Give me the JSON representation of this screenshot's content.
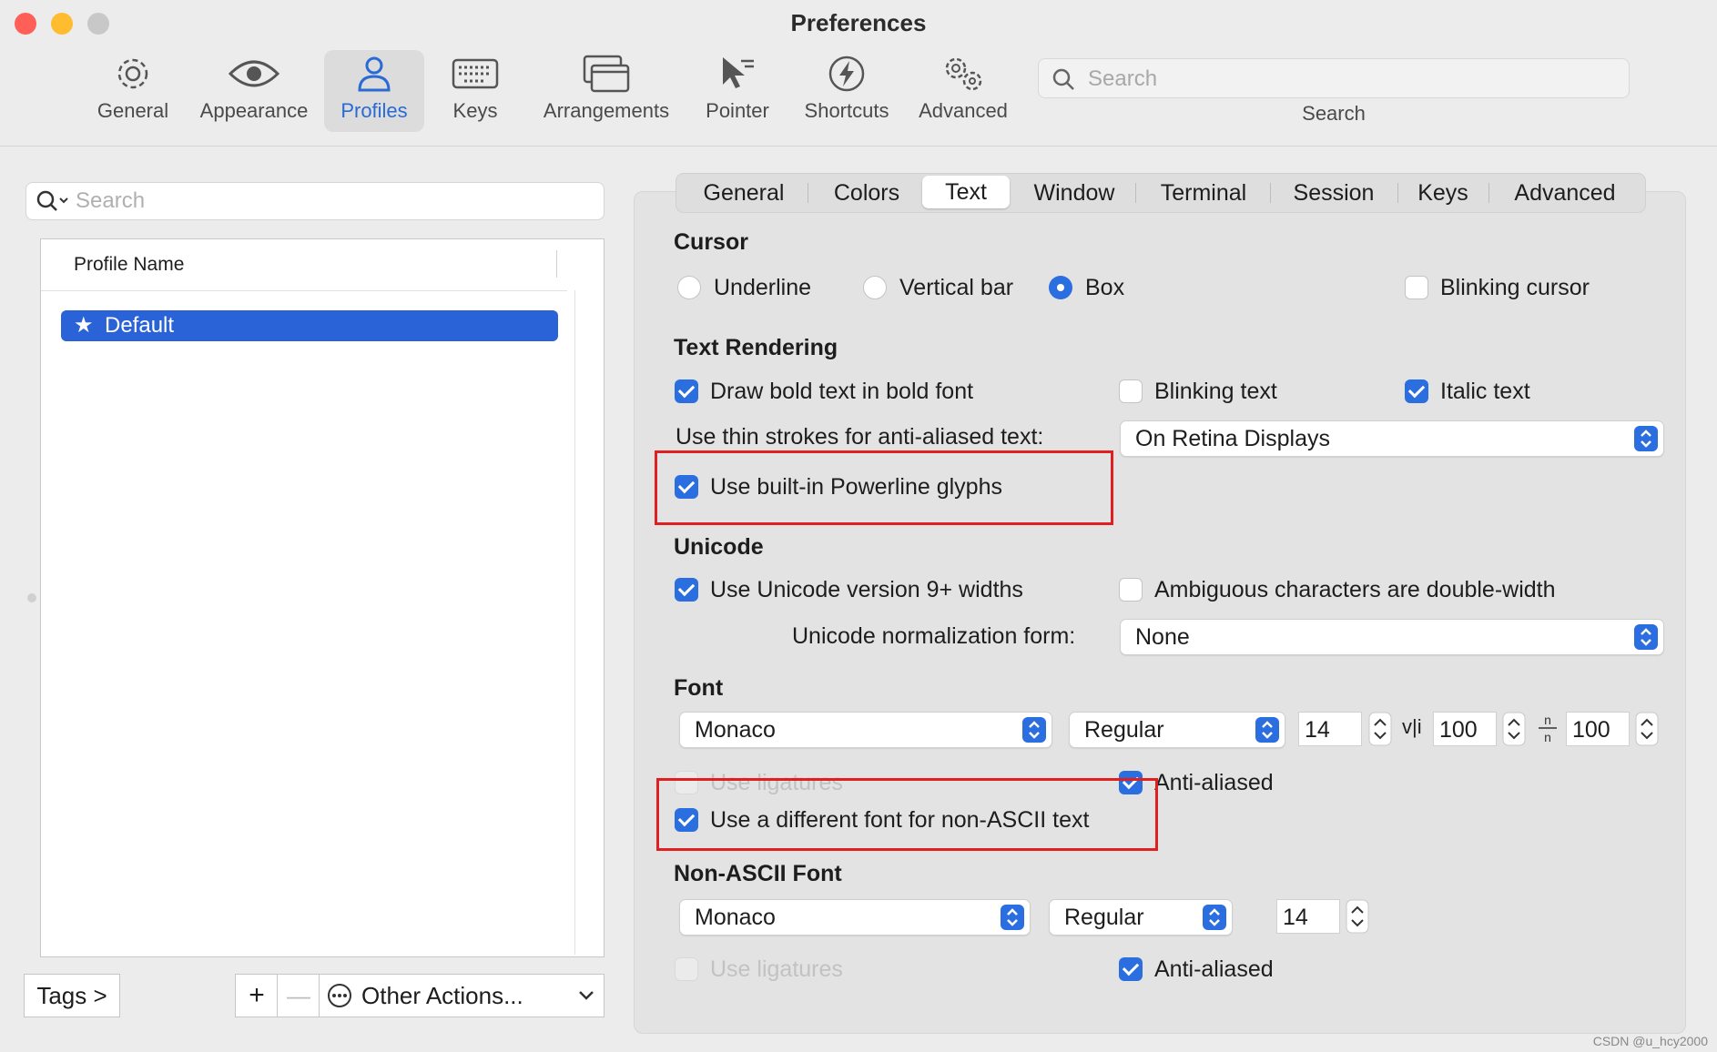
{
  "window": {
    "title": "Preferences"
  },
  "toolbar": {
    "items": [
      {
        "label": "General",
        "icon": "gear-icon"
      },
      {
        "label": "Appearance",
        "icon": "eye-icon"
      },
      {
        "label": "Profiles",
        "icon": "person-icon",
        "selected": true
      },
      {
        "label": "Keys",
        "icon": "keyboard-icon"
      },
      {
        "label": "Arrangements",
        "icon": "windows-icon"
      },
      {
        "label": "Pointer",
        "icon": "pointer-icon"
      },
      {
        "label": "Shortcuts",
        "icon": "bolt-icon"
      },
      {
        "label": "Advanced",
        "icon": "gears-icon"
      }
    ],
    "search_placeholder": "Search",
    "search_label": "Search"
  },
  "profiles": {
    "search_placeholder": "Search",
    "column_header": "Profile Name",
    "items": [
      {
        "name": "Default",
        "starred": true,
        "selected": true
      }
    ],
    "tags_button": "Tags >",
    "add_symbol": "+",
    "remove_symbol": "—",
    "other_actions": "Other Actions..."
  },
  "tabs": [
    "General",
    "Colors",
    "Text",
    "Window",
    "Terminal",
    "Session",
    "Keys",
    "Advanced"
  ],
  "selected_tab": "Text",
  "cursor": {
    "heading": "Cursor",
    "options": [
      "Underline",
      "Vertical bar",
      "Box"
    ],
    "selected": "Box",
    "blinking_label": "Blinking cursor",
    "blinking": false
  },
  "text_rendering": {
    "heading": "Text Rendering",
    "bold_label": "Draw bold text in bold font",
    "bold": true,
    "blinking_text_label": "Blinking text",
    "blinking_text": false,
    "italic_label": "Italic text",
    "italic": true,
    "thin_strokes_label": "Use thin strokes for anti-aliased text:",
    "thin_strokes_value": "On Retina Displays",
    "powerline_label": "Use built-in Powerline glyphs",
    "powerline": true
  },
  "unicode": {
    "heading": "Unicode",
    "v9_label": "Use Unicode version 9+ widths",
    "v9": true,
    "ambiguous_label": "Ambiguous characters are double-width",
    "ambiguous": false,
    "normalization_label": "Unicode normalization form:",
    "normalization_value": "None"
  },
  "font": {
    "heading": "Font",
    "family": "Monaco",
    "style": "Regular",
    "size": "14",
    "vspace_glyph": "v|i",
    "vspace": "100",
    "hspace": "100",
    "ligatures_label": "Use ligatures",
    "ligatures": false,
    "antialiased_label": "Anti-aliased",
    "antialiased": true,
    "non_ascii_label": "Use a different font for non-ASCII text",
    "non_ascii": true
  },
  "non_ascii_font": {
    "heading": "Non-ASCII Font",
    "family": "Monaco",
    "style": "Regular",
    "size": "14",
    "ligatures_label": "Use ligatures",
    "ligatures": false,
    "antialiased_label": "Anti-aliased",
    "antialiased": true
  },
  "watermark": "CSDN @u_hcy2000",
  "colors": {
    "accent": "#2a6ee0",
    "highlight": "#e02020",
    "selection": "#2a62d7"
  }
}
